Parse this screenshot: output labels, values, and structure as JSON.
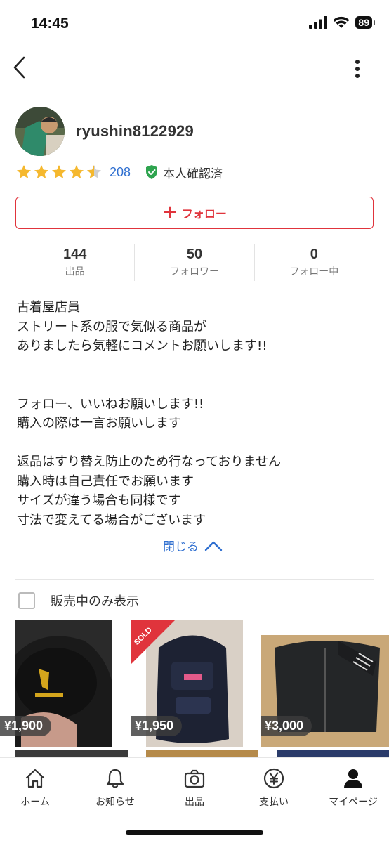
{
  "status": {
    "time": "14:45",
    "battery": "89"
  },
  "profile": {
    "username": "ryushin8122929",
    "rating": 4.5,
    "review_count": "208",
    "verified_label": "本人確認済"
  },
  "follow_label": "フォロー",
  "stats": [
    {
      "value": "144",
      "label": "出品"
    },
    {
      "value": "50",
      "label": "フォロワー"
    },
    {
      "value": "0",
      "label": "フォロー中"
    }
  ],
  "bio_lines": [
    "古着屋店員",
    "ストリート系の服で気似る商品が",
    "ありましたら気軽にコメントお願いします!!",
    "",
    "",
    "フォロー、いいねお願いします!!",
    "購入の際は一言お願いします",
    "",
    "返品はすり替え防止のため行なっておりません",
    "購入時は自己責任でお願います",
    "サイズが違う場合も同様です",
    "寸法で変えてる場合がございます"
  ],
  "close_label": "閉じる",
  "filter_label": "販売中のみ表示",
  "items": [
    {
      "price": "¥1,900",
      "sold": false
    },
    {
      "price": "¥1,950",
      "sold": true,
      "sold_label": "SOLD"
    },
    {
      "price": "¥3,000",
      "sold": false
    }
  ],
  "tabs": [
    {
      "label": "ホーム",
      "icon": "home-icon"
    },
    {
      "label": "お知らせ",
      "icon": "bell-icon"
    },
    {
      "label": "出品",
      "icon": "camera-icon"
    },
    {
      "label": "支払い",
      "icon": "yen-icon"
    },
    {
      "label": "マイページ",
      "icon": "person-icon"
    }
  ],
  "colors": {
    "accent_red": "#e0343c",
    "link_blue": "#2f6fd0",
    "star": "#f5b82e",
    "verified_green": "#2ea44f"
  }
}
